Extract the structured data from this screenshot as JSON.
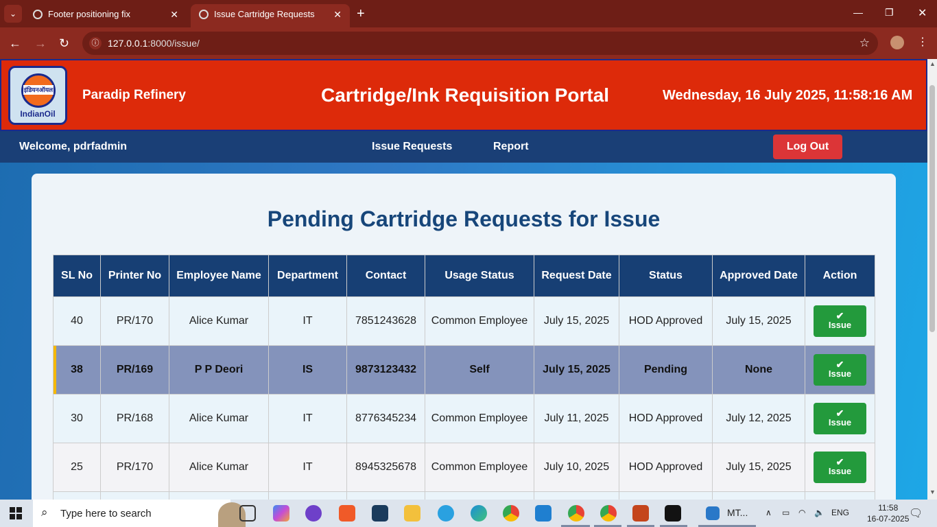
{
  "browser": {
    "tabs": [
      {
        "title": "Footer positioning fix",
        "favicon": "chatgpt-icon"
      },
      {
        "title": "Issue Cartridge Requests",
        "favicon": "globe-icon"
      }
    ],
    "url_host": "127.0.0.1",
    "url_rest": ":8000/issue/"
  },
  "header": {
    "logo_band": "इंडियनऑयल",
    "logo_text": "IndianOil",
    "org": "Paradip Refinery",
    "title": "Cartridge/Ink Requisition Portal",
    "datetime": "Wednesday, 16 July 2025, 11:58:16 AM"
  },
  "nav": {
    "welcome": "Welcome, pdrfadmin",
    "links": [
      "Issue Requests",
      "Report"
    ],
    "logout": "Log Out"
  },
  "main": {
    "title": "Pending Cartridge Requests for Issue",
    "columns": [
      "SL No",
      "Printer No",
      "Employee Name",
      "Department",
      "Contact",
      "Usage Status",
      "Request Date",
      "Status",
      "Approved Date",
      "Action"
    ],
    "action_label": "Issue",
    "rows": [
      [
        "40",
        "PR/170",
        "Alice Kumar",
        "IT",
        "7851243628",
        "Common Employee",
        "July 15, 2025",
        "HOD Approved",
        "July 15, 2025"
      ],
      [
        "38",
        "PR/169",
        "P P Deori",
        "IS",
        "9873123432",
        "Self",
        "July 15, 2025",
        "Pending",
        "None"
      ],
      [
        "30",
        "PR/168",
        "Alice Kumar",
        "IT",
        "8776345234",
        "Common Employee",
        "July 11, 2025",
        "HOD Approved",
        "July 12, 2025"
      ],
      [
        "25",
        "PR/170",
        "Alice Kumar",
        "IT",
        "8945325678",
        "Common Employee",
        "July 10, 2025",
        "HOD Approved",
        "July 15, 2025"
      ]
    ]
  },
  "taskbar": {
    "search_placeholder": "Type here to search",
    "mt_label": "MT...",
    "lang": "ENG",
    "time": "11:58",
    "date": "16-07-2025"
  },
  "colors": {
    "header_red": "#dd2a0a",
    "nav_blue": "#1a3f76",
    "table_header": "#173f74",
    "issue_green": "#239a3c",
    "logout_red": "#dc3537"
  }
}
